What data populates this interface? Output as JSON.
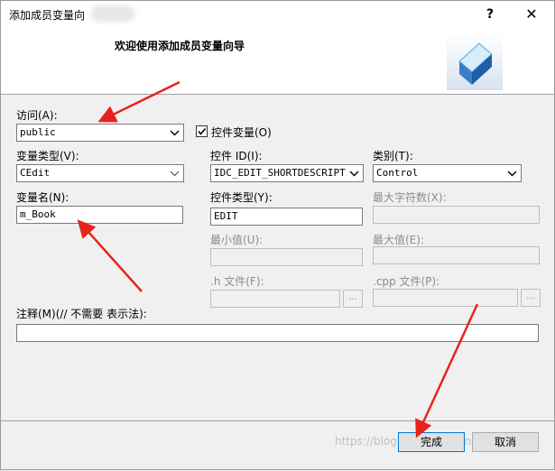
{
  "window": {
    "title": "添加成员变量向",
    "help_glyph": "?",
    "close_glyph": "✕"
  },
  "header": {
    "title": "欢迎使用添加成员变量向导"
  },
  "form": {
    "access": {
      "label": "访问(A):",
      "value": "public"
    },
    "control_var": {
      "label": "控件变量(O)",
      "checked": true
    },
    "var_type": {
      "label": "变量类型(V):",
      "value": "CEdit"
    },
    "control_id": {
      "label": "控件 ID(I):",
      "value": "IDC_EDIT_SHORTDESCRIPTIO"
    },
    "category": {
      "label": "类别(T):",
      "value": "Control"
    },
    "var_name": {
      "label": "变量名(N):",
      "value": "m_Book"
    },
    "control_type": {
      "label": "控件类型(Y):",
      "value": "EDIT"
    },
    "max_chars": {
      "label": "最大字符数(X):",
      "value": ""
    },
    "min_value": {
      "label": "最小值(U):",
      "value": ""
    },
    "max_value": {
      "label": "最大值(E):",
      "value": ""
    },
    "h_file": {
      "label": ".h 文件(F):",
      "value": "",
      "browse": "..."
    },
    "cpp_file": {
      "label": ".cpp 文件(P):",
      "value": "",
      "browse": "..."
    },
    "comment": {
      "label": "注释(M)(// 不需要 表示法):",
      "value": ""
    }
  },
  "buttons": {
    "finish": "完成",
    "cancel": "取消"
  },
  "watermark": "https://blog.csdn.net/hans_xiaolei",
  "colors": {
    "annotation_arrow": "#e8231e",
    "dialog_bg": "#f0f0f0",
    "header_bg": "#ffffff",
    "focus_border": "#0078d7"
  }
}
